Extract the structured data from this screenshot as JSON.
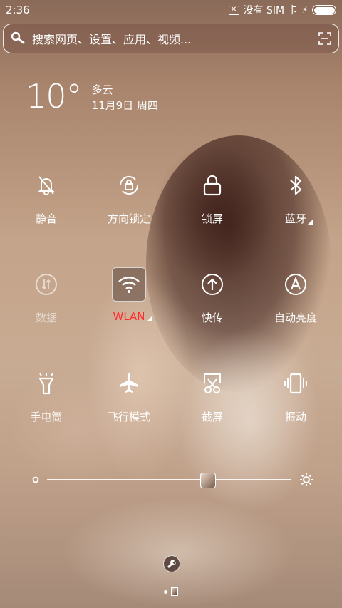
{
  "status_bar": {
    "time": "2:36",
    "network": "没有 SIM 卡",
    "no_data_icon": "x-box-icon",
    "charging_icon": "bolt-icon",
    "battery_level": 1.0
  },
  "search": {
    "placeholder": "搜索网页、设置、应用、视频..."
  },
  "weather": {
    "temperature": "10°",
    "condition": "多云",
    "date": "11月9日 周四"
  },
  "quick_settings": [
    {
      "label": "静音",
      "icon": "bell-off-icon",
      "state": "off"
    },
    {
      "label": "方向锁定",
      "icon": "rotation-lock-icon",
      "state": "off"
    },
    {
      "label": "锁屏",
      "icon": "lock-icon",
      "state": "off"
    },
    {
      "label": "蓝牙",
      "icon": "bluetooth-icon",
      "state": "off"
    },
    {
      "label": "数据",
      "icon": "mobile-data-icon",
      "state": "disabled"
    },
    {
      "label": "WLAN",
      "icon": "wifi-icon",
      "state": "on"
    },
    {
      "label": "快传",
      "icon": "upload-icon",
      "state": "off"
    },
    {
      "label": "自动亮度",
      "icon": "auto-brightness-icon",
      "state": "off"
    },
    {
      "label": "手电筒",
      "icon": "flashlight-icon",
      "state": "off"
    },
    {
      "label": "飞行模式",
      "icon": "airplane-icon",
      "state": "off"
    },
    {
      "label": "截屏",
      "icon": "screenshot-icon",
      "state": "off"
    },
    {
      "label": "振动",
      "icon": "vibrate-icon",
      "state": "off"
    }
  ],
  "brightness": {
    "level": 0.66
  },
  "colors": {
    "active_label": "#ff2b2b"
  }
}
